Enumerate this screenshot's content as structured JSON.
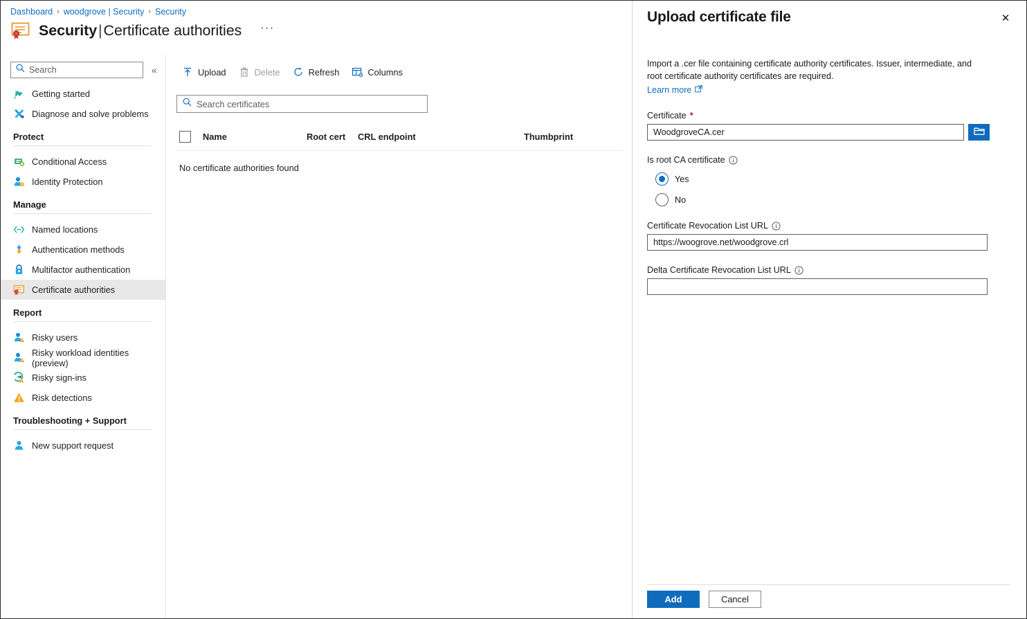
{
  "breadcrumb": {
    "items": [
      "Dashboard",
      "woodgrove | Security",
      "Security"
    ],
    "separator": "›"
  },
  "header": {
    "icon": "certificate-icon",
    "title_main": "Security",
    "title_separator": "|",
    "title_sub": "Certificate authorities",
    "ellipsis": "···"
  },
  "sidebar": {
    "search_placeholder": "Search",
    "collapse_glyph": "«",
    "top_items": [
      {
        "label": "Getting started",
        "icon": "rocket-icon",
        "selected": false
      },
      {
        "label": "Diagnose and solve problems",
        "icon": "wrench-icon",
        "selected": false
      }
    ],
    "groups": [
      {
        "label": "Protect",
        "items": [
          {
            "label": "Conditional Access",
            "icon": "conditional-access-icon",
            "selected": false
          },
          {
            "label": "Identity Protection",
            "icon": "identity-protection-icon",
            "selected": false
          }
        ]
      },
      {
        "label": "Manage",
        "items": [
          {
            "label": "Named locations",
            "icon": "named-locations-icon",
            "selected": false
          },
          {
            "label": "Authentication methods",
            "icon": "authentication-methods-icon",
            "selected": false
          },
          {
            "label": "Multifactor authentication",
            "icon": "lock-icon",
            "selected": false
          },
          {
            "label": "Certificate authorities",
            "icon": "certificate-icon",
            "selected": true
          }
        ]
      },
      {
        "label": "Report",
        "items": [
          {
            "label": "Risky users",
            "icon": "risky-user-icon",
            "selected": false
          },
          {
            "label": "Risky workload identities (preview)",
            "icon": "risky-workload-icon",
            "selected": false
          },
          {
            "label": "Risky sign-ins",
            "icon": "risky-signin-icon",
            "selected": false
          },
          {
            "label": "Risk detections",
            "icon": "warning-triangle-icon",
            "selected": false
          }
        ]
      },
      {
        "label": "Troubleshooting + Support",
        "items": [
          {
            "label": "New support request",
            "icon": "support-person-icon",
            "selected": false
          }
        ]
      }
    ]
  },
  "toolbar": {
    "buttons": [
      {
        "label": "Upload",
        "icon": "upload-arrow-icon",
        "disabled": false
      },
      {
        "label": "Delete",
        "icon": "trash-icon",
        "disabled": true
      },
      {
        "label": "Refresh",
        "icon": "refresh-icon",
        "disabled": false
      },
      {
        "label": "Columns",
        "icon": "columns-icon",
        "disabled": false
      }
    ]
  },
  "table": {
    "search_placeholder": "Search certificates",
    "columns": [
      "Name",
      "Root cert",
      "CRL endpoint",
      "Thumbprint"
    ],
    "rows": [],
    "empty_message": "No certificate authorities found"
  },
  "panel": {
    "title": "Upload certificate file",
    "close_glyph": "✕",
    "description": "Import a .cer file containing certificate authority certificates. Issuer, intermediate, and root certificate authority certificates are required.",
    "learn_more": "Learn more",
    "learn_more_icon": "external-link-icon",
    "fields": {
      "certificate": {
        "label": "Certificate",
        "required_marker": "*",
        "value": "WoodgroveCA.cer",
        "browse_icon": "folder-icon"
      },
      "is_root_ca": {
        "label": "Is root CA certificate",
        "info_icon": "info-icon",
        "options": [
          {
            "label": "Yes",
            "selected": true
          },
          {
            "label": "No",
            "selected": false
          }
        ]
      },
      "crl_url": {
        "label": "Certificate Revocation List URL",
        "info_icon": "info-icon",
        "value": "https://woogrove.net/woodgrove.crl",
        "placeholder": ""
      },
      "delta_crl_url": {
        "label": "Delta Certificate Revocation List URL",
        "info_icon": "info-icon",
        "value": "",
        "placeholder": ""
      }
    },
    "footer": {
      "primary": "Add",
      "secondary": "Cancel"
    }
  },
  "colors": {
    "accent_blue": "#0f6cbd",
    "link_blue": "#0f6cbd",
    "required_red": "#a4262c",
    "selected_bg": "#e9e8e7",
    "text": "#1b1a19"
  }
}
